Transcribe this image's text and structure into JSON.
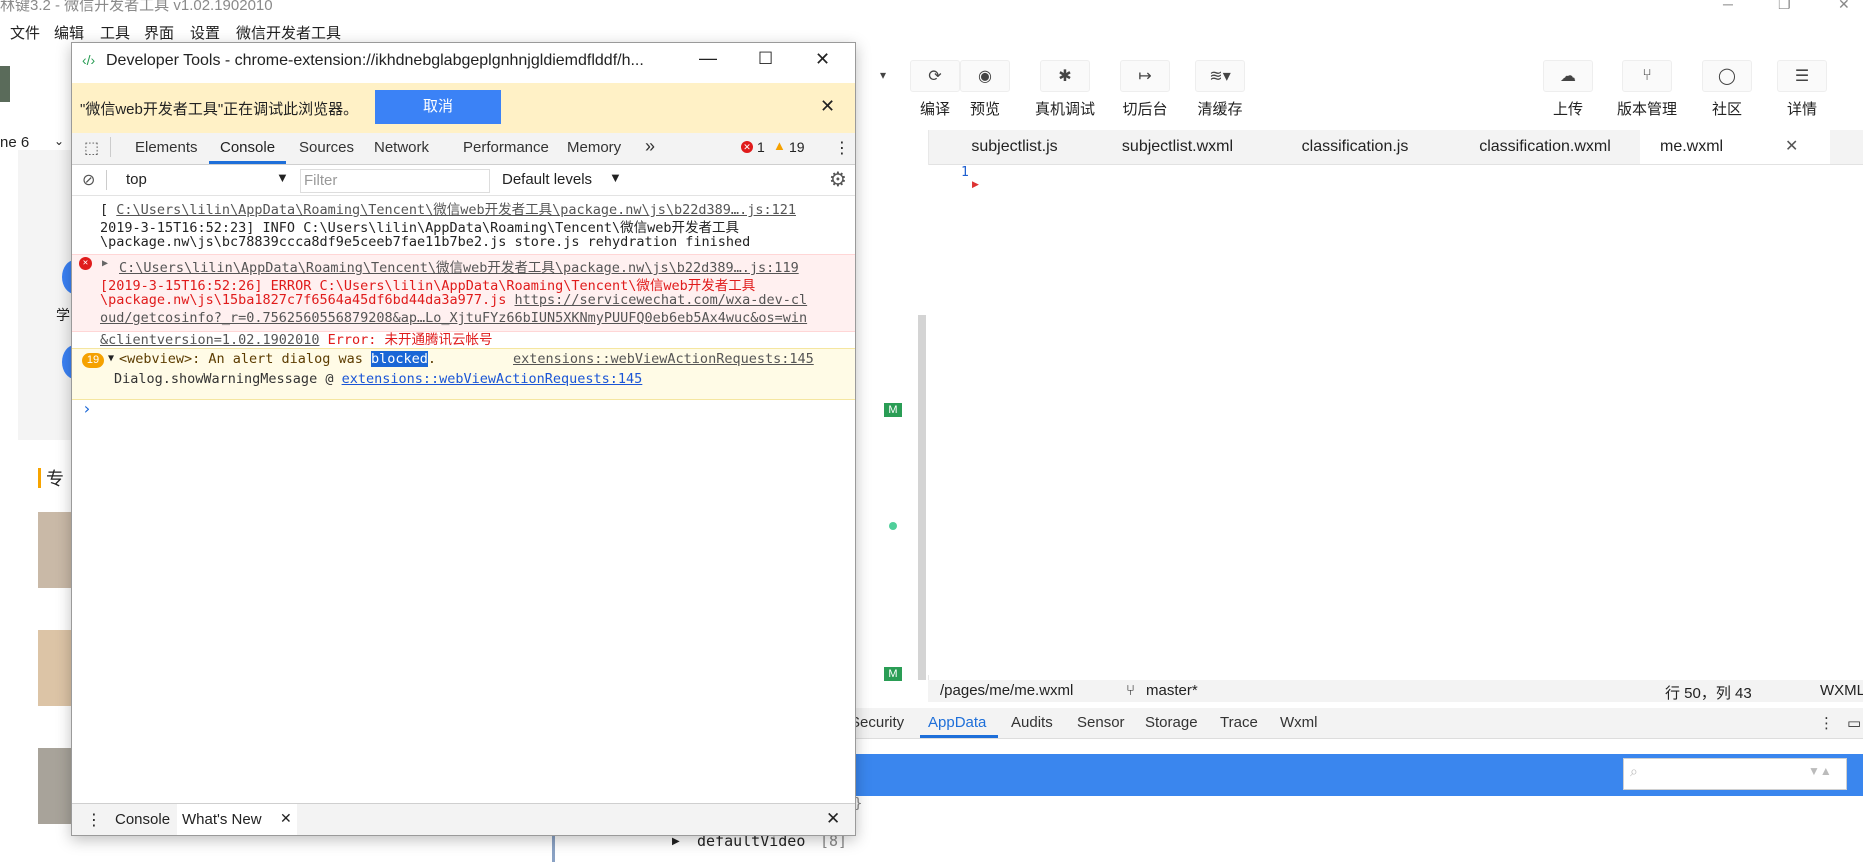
{
  "app": {
    "title": "林键3.2 - 微信开发者工具 v1.02.1902010"
  },
  "menu": [
    "文件",
    "编辑",
    "工具",
    "界面",
    "设置",
    "微信开发者工具"
  ],
  "toolbar": {
    "items": [
      {
        "label": "编译",
        "icon": "refresh-icon"
      },
      {
        "label": "预览",
        "icon": "eye-icon"
      },
      {
        "label": "真机调试",
        "icon": "bug-icon"
      },
      {
        "label": "切后台",
        "icon": "switch-icon"
      },
      {
        "label": "清缓存",
        "icon": "layers-icon"
      },
      {
        "label": "上传",
        "icon": "cloud-upload-icon"
      },
      {
        "label": "版本管理",
        "icon": "branch-icon"
      },
      {
        "label": "社区",
        "icon": "chat-icon"
      },
      {
        "label": "详情",
        "icon": "menu-icon"
      }
    ]
  },
  "device": {
    "label": "ne 6"
  },
  "editor": {
    "tabs": [
      "subjectlist.js",
      "subjectlist.wxml",
      "classification.js",
      "classification.wxml",
      "me.wxml"
    ],
    "active_tab": "me.wxml",
    "line_number": "1",
    "status": {
      "path": "/pages/me/me.wxml",
      "branch": "master*",
      "position": "行 50，列 43",
      "lang": "WXML"
    }
  },
  "panel": {
    "tabs": [
      "Security",
      "AppData",
      "Audits",
      "Sensor",
      "Storage",
      "Trace",
      "Wxml"
    ],
    "active": "AppData",
    "tree_item": "defaultVideo",
    "tree_count": "[8]",
    "brace": "}"
  },
  "simulator": {
    "stub_text_1": "学",
    "stub_text_2": "专"
  },
  "devtools": {
    "title": "Developer Tools - chrome-extension://ikhdnebglabgeplgnhnjgldiemdflddf/h...",
    "banner_text": "\"微信web开发者工具\"正在调试此浏览器。",
    "cancel_label": "取消",
    "tabs": [
      "Elements",
      "Console",
      "Sources",
      "Network",
      "Performance",
      "Memory"
    ],
    "more": "»",
    "active_tab": "Console",
    "error_count": "1",
    "warning_count": "19",
    "context": "top",
    "filter_placeholder": "Filter",
    "levels": "Default levels",
    "log": {
      "info_link": "C:\\Users\\lilin\\AppData\\Roaming\\Tencent\\微信web开发者工具\\package.nw\\js\\b22d389….js:121",
      "info_line1": "2019-3-15T16:52:23] INFO C:\\Users\\lilin\\AppData\\Roaming\\Tencent\\微信web开发者工具",
      "info_line2": "\\package.nw\\js\\bc78839ccca8df9e5ceeb7fae11b7be2.js store.js rehydration finished",
      "error_link": "C:\\Users\\lilin\\AppData\\Roaming\\Tencent\\微信web开发者工具\\package.nw\\js\\b22d389….js:119",
      "error_line1": "[2019-3-15T16:52:26] ERROR C:\\Users\\lilin\\AppData\\Roaming\\Tencent\\微信web开发者工具",
      "error_line2_a": "\\package.nw\\js\\15ba1827c7f6564a45df6bd44da3a977.js ",
      "error_line2_b": "https://servicewechat.com/wxa-dev-cl",
      "error_line3": "oud/getcosinfo?_r=0.7562560556879208&ap…Lo_XjtuFYz66bIUN5XKNmyPUUFQ0eb6eb5Ax4wuc&os=win",
      "error_line4": "&clientversion=1.02.1902010",
      "error_msg": "Error: 未开通腾讯云帐号",
      "warn_count": "19",
      "warn_prefix": "<webview>: An alert dialog was ",
      "warn_highlight": "blocked",
      "warn_suffix": ".",
      "warn_source": "extensions::webViewActionRequests:145",
      "warn_stack_fn": "Dialog.showWarningMessage @ ",
      "warn_stack_link": "extensions::webViewActionRequests:145",
      "prompt": "›"
    },
    "drawer_tabs": [
      "Console",
      "What's New"
    ]
  },
  "colors": {
    "accent": "#1e6fd9",
    "banner": "#fff1c6",
    "error": "#e01b1b",
    "cancel": "#3b82f6",
    "appdata_bar": "#3a86ee"
  }
}
